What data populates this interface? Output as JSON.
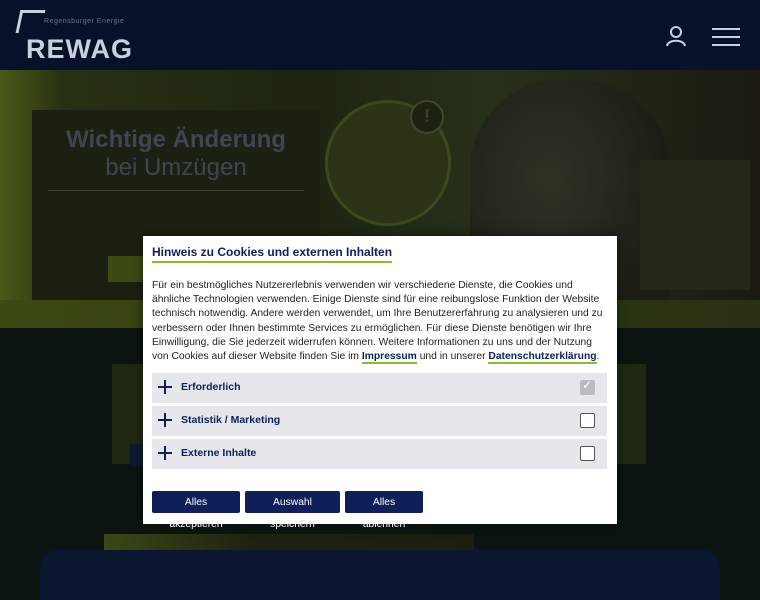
{
  "header": {
    "logo_text": "REWAG",
    "logo_small": "Regensburger Energie"
  },
  "hero": {
    "title": "Wichtige Änderung",
    "subtitle": "bei Umzügen",
    "text": "",
    "circle_text": "",
    "alert_symbol": "!"
  },
  "modal": {
    "title": "Hinweis zu Cookies und externen Inhalten",
    "body_1": "Für ein bestmögliches Nutzererlebnis verwenden wir verschiedene Dienste, die Cookies und ähnliche Technologien verwenden. Einige Dienste sind für eine reibungslose Funktion der Website technisch notwendig. Andere werden verwendet, um Ihre Benutzererfahrung zu analysieren und zu verbessern oder Ihnen bestimmte Services zu ermöglichen. Für diese Dienste benötigen wir Ihre Einwilligung, die Sie jederzeit widerrufen können. Weitere Informationen zu uns und der Nutzung von Cookies auf dieser Website finden Sie im ",
    "link_impressum": "Impressum",
    "body_2": " und in unserer ",
    "link_datenschutz": "Datenschutzerklärung",
    "body_3": ".",
    "categories": [
      {
        "label": "Erforderlich",
        "checked": true,
        "disabled": true
      },
      {
        "label": "Statistik / Marketing",
        "checked": false,
        "disabled": false
      },
      {
        "label": "Externe Inhalte",
        "checked": false,
        "disabled": false
      }
    ],
    "buttons": {
      "accept_all": "Alles akzeptieren",
      "save_selection": "Auswahl speichern",
      "reject_all": "Alles ablehnen"
    }
  },
  "colors": {
    "brand_navy": "#0e1f5a",
    "accent_green": "#8dbb2f",
    "category_bg": "#e6e7ea"
  }
}
